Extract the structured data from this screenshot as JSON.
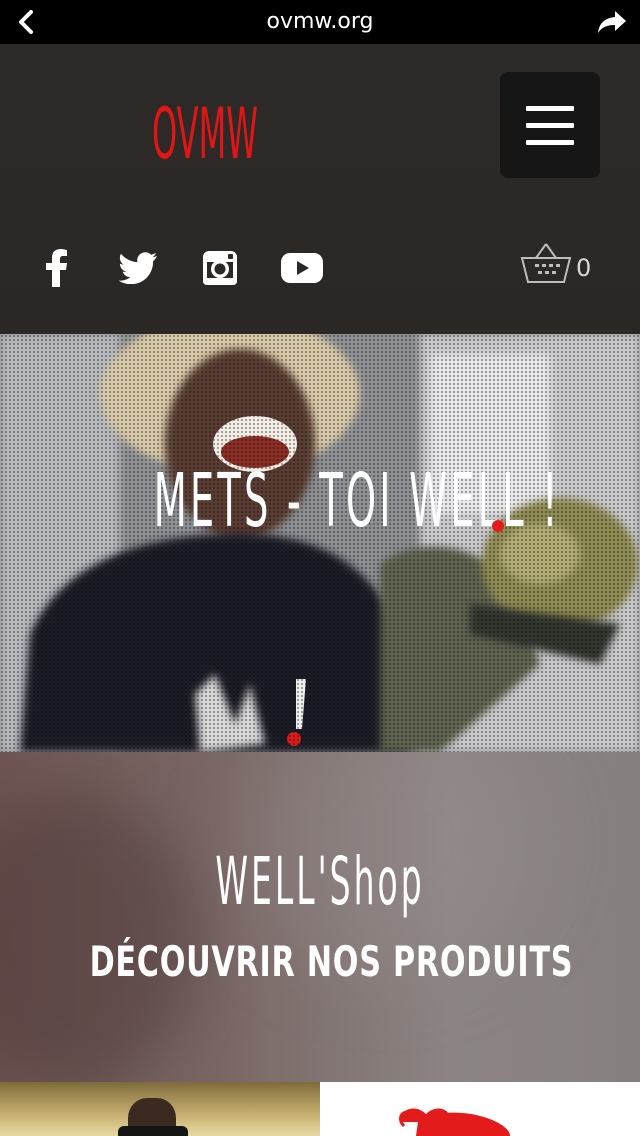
{
  "browser": {
    "url": "ovmw.org"
  },
  "header": {
    "logo_text": "OVMW",
    "cart_count": "0",
    "social": [
      "facebook-icon",
      "twitter-icon",
      "instagram-icon",
      "youtube-icon"
    ]
  },
  "hero": {
    "title": "METS - TOI WELL !"
  },
  "shop": {
    "title": "WELL'Shop",
    "cta": "DÉCOUVRIR NOS PRODUITS"
  },
  "colors": {
    "brand_red": "#e31b1b",
    "header_bg": "#2d2a28",
    "menu_bg": "#161616"
  }
}
